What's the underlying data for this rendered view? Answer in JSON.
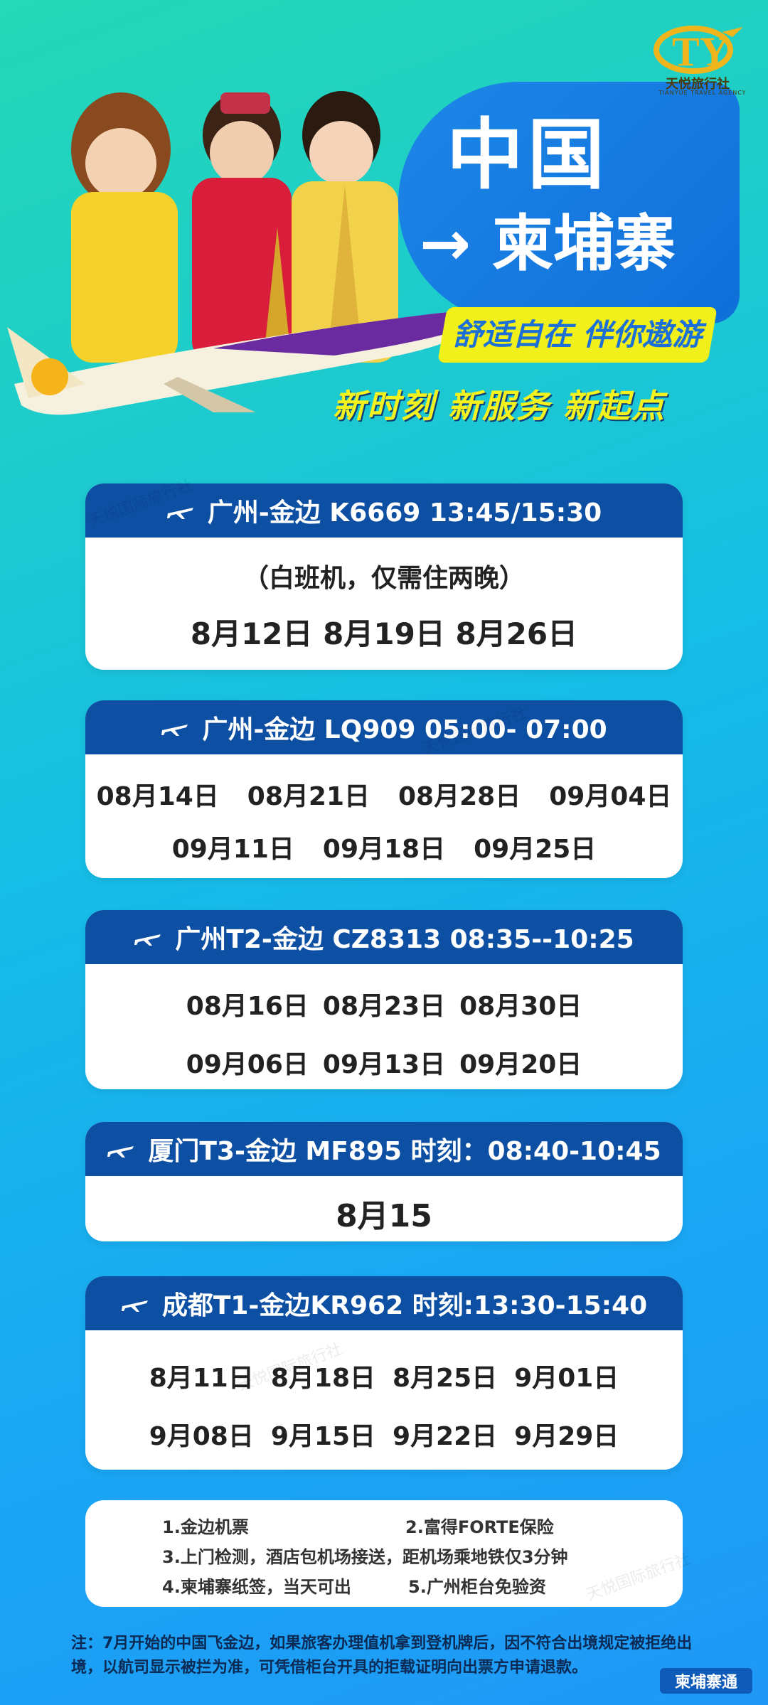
{
  "brand": {
    "name": "天悦旅行社",
    "sub": "TIANYUE TRAVEL AGENCY"
  },
  "hero": {
    "line1": "中国",
    "line2": "→ 柬埔寨",
    "slogan1": "舒适自在 伴你遨游",
    "slogan2": "新时刻 新服务 新起点"
  },
  "flights": [
    {
      "header": "广州-金边    K6669    13:45/15:30",
      "lines": [
        "（白班机，仅需住两晚）",
        "8月12日  8月19日  8月26日"
      ]
    },
    {
      "header": "广州-金边    LQ909 05:00- 07:00",
      "rows": [
        [
          "08月14日",
          "08月21日",
          "08月28日",
          "09月04日"
        ],
        [
          "09月11日",
          "09月18日",
          "09月25日"
        ]
      ]
    },
    {
      "header": "广州T2-金边 CZ8313 08:35--10:25",
      "rows": [
        [
          "08月16日",
          "08月23日",
          "08月30日"
        ],
        [
          "09月06日",
          "09月13日",
          "09月20日"
        ]
      ]
    },
    {
      "header": "厦门T3-金边 MF895 时刻：08:40-10:45",
      "rows": [
        [
          "8月15"
        ]
      ]
    },
    {
      "header": "成都T1-金边KR962 时刻:13:30-15:40",
      "rows": [
        [
          "8月11日",
          "8月18日",
          "8月25日",
          "9月01日"
        ],
        [
          "9月08日",
          "9月15日",
          "9月22日",
          "9月29日"
        ]
      ]
    }
  ],
  "notes": {
    "n1": "1.金边机票",
    "n2": "2.富得FORTE保险",
    "n3": "3.上门检测，酒店包机场接送，距机场乘地铁仅3分钟",
    "n4": "4.柬埔寨纸签，当天可出",
    "n5": "5.广州柜台免验资"
  },
  "footer": "注：7月开始的中国飞金边，如果旅客办理值机拿到登机牌后，因不符合出境规定被拒绝出境，以航司显示被拦为准，可凭借柜台开具的拒载证明向出票方申请退款。",
  "badge": "柬埔寨通",
  "watermark": "天悦国际旅行社",
  "colors": {
    "header_blue": "#0d4fa3",
    "accent_yellow": "#f2f01a"
  }
}
